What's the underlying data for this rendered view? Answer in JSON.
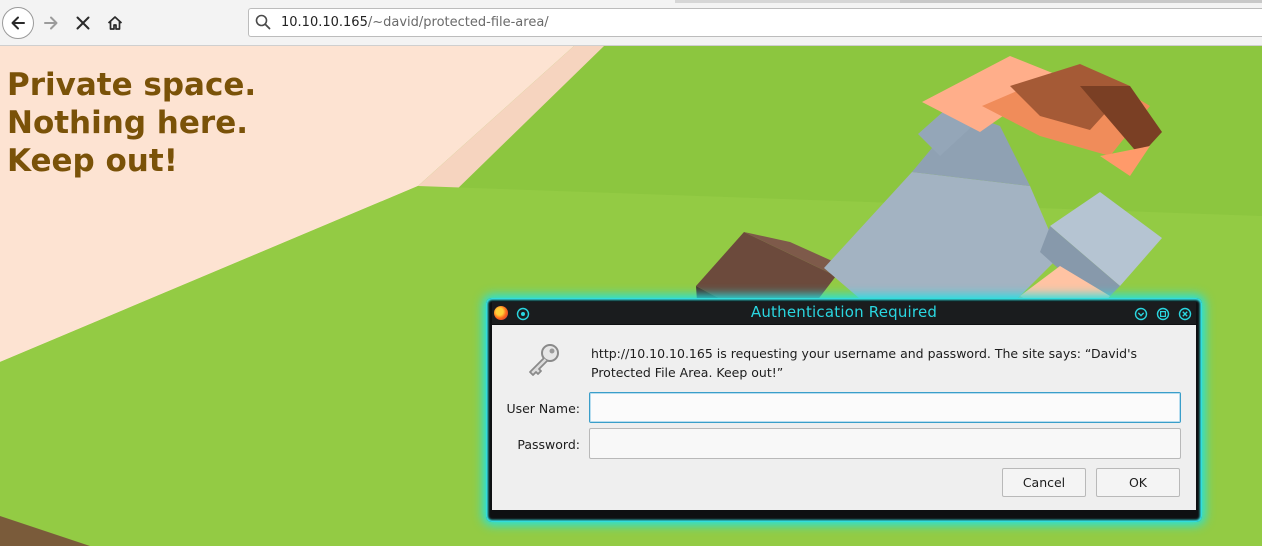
{
  "browser": {
    "url_host": "10.10.10.165",
    "url_path": "/~david/protected-file-area/",
    "icons": {
      "back": "back-arrow-icon",
      "forward": "forward-arrow-icon",
      "stop": "stop-icon",
      "home": "home-icon",
      "search": "search-icon"
    }
  },
  "page": {
    "hero_lines": [
      "Private space.",
      "Nothing here.",
      "Keep out!"
    ],
    "colors": {
      "hero_text": "#7a5208",
      "peach": "#fde3d2",
      "grass": "#8cc63f"
    }
  },
  "dialog": {
    "title": "Authentication Required",
    "message": "http://10.10.10.165 is requesting your username and password. The site says: “David's Protected File Area. Keep out!”",
    "username_label": "User Name:",
    "username_value": "",
    "password_label": "Password:",
    "password_value": "",
    "cancel_label": "Cancel",
    "ok_label": "OK",
    "accent_color": "#2ad6e0",
    "icons": {
      "app": "firefox-icon",
      "pin": "pin-icon",
      "minimize": "minimize-icon",
      "maximize": "maximize-icon",
      "close": "close-icon",
      "key": "key-icon"
    }
  }
}
